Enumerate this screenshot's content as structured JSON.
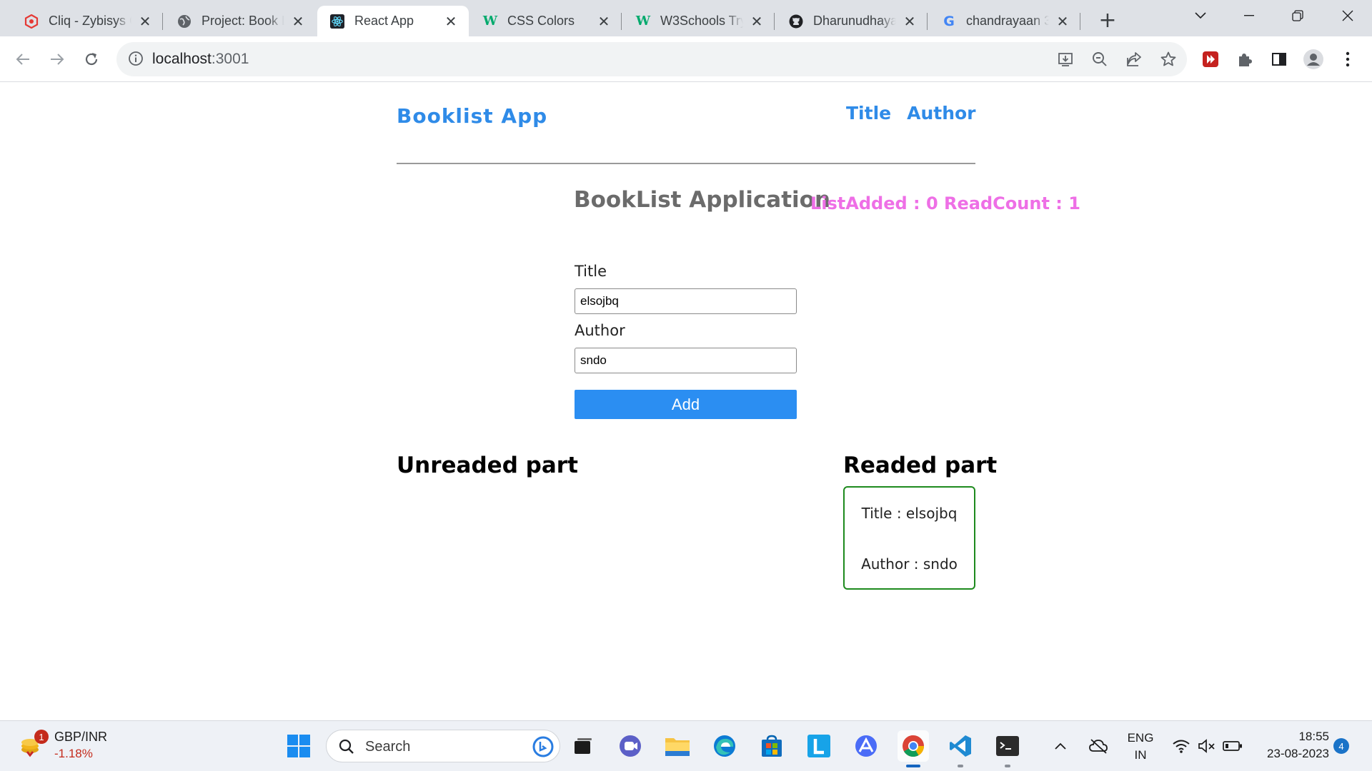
{
  "browser": {
    "tabs": [
      {
        "title": "Cliq - Zybisys C",
        "icon": "cliq-icon"
      },
      {
        "title": "Project: Book L",
        "icon": "globe-icon"
      },
      {
        "title": "React App",
        "icon": "react-icon",
        "active": true
      },
      {
        "title": "CSS Colors",
        "icon": "w3schools-icon"
      },
      {
        "title": "W3Schools Try",
        "icon": "w3schools-icon"
      },
      {
        "title": "Dharunudhaya",
        "icon": "github-icon"
      },
      {
        "title": "chandrayaan 3",
        "icon": "google-icon"
      }
    ],
    "address": {
      "host": "localhost",
      "port": ":3001"
    }
  },
  "app": {
    "brand": "Booklist App",
    "nav": {
      "title_link": "Title",
      "author_link": "Author"
    },
    "heading": "BookList Application",
    "counts": "ListAdded : 0 ReadCount : 1",
    "form": {
      "title_label": "Title",
      "title_value": "elsojbq",
      "author_label": "Author",
      "author_value": "sndo",
      "add_label": "Add"
    },
    "unread_heading": "Unreaded part",
    "read_heading": "Readed part",
    "read_items": [
      {
        "title_line": "Title : elsojbq",
        "author_line": "Author : sndo"
      }
    ],
    "colors": {
      "brand": "#2f8be8",
      "counts": "#ee6fe6",
      "button": "#2b8ef2",
      "card_border": "#1e8a1e"
    }
  },
  "taskbar": {
    "widget": {
      "name": "GBP/INR",
      "change": "-1.18%",
      "badge": "1"
    },
    "search_placeholder": "Search",
    "lang": {
      "line1": "ENG",
      "line2": "IN"
    },
    "clock": {
      "time": "18:55",
      "date": "23-08-2023"
    },
    "notifications": "4"
  }
}
